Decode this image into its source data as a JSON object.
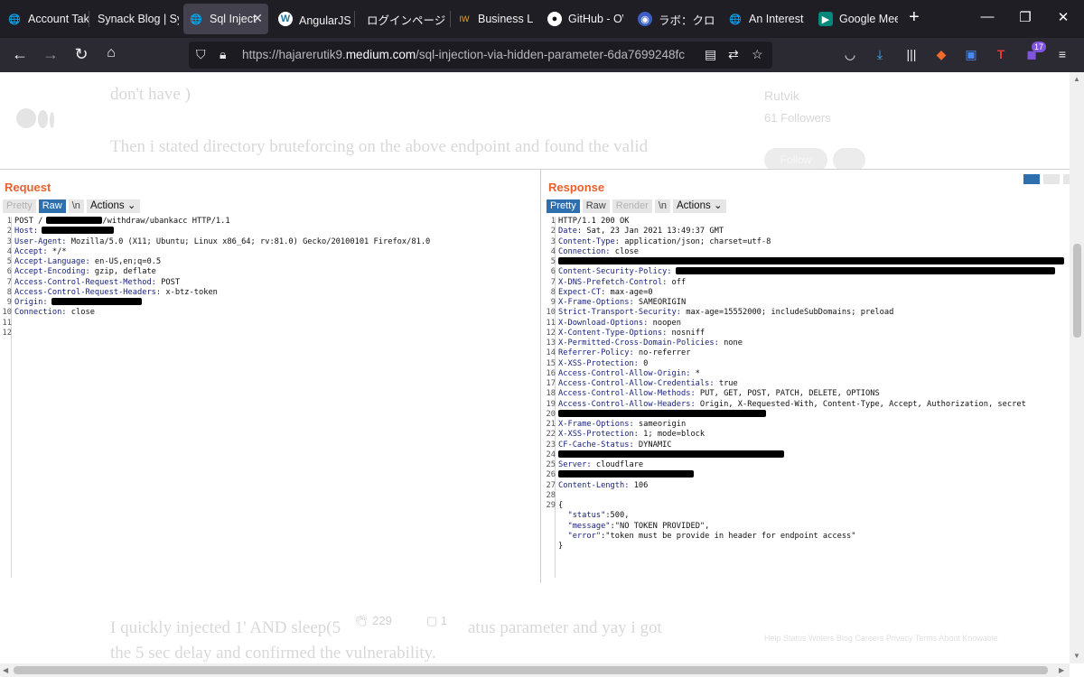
{
  "tabs": [
    {
      "title": "Account Tak",
      "icon": "globe-icon",
      "active": false
    },
    {
      "title": "Synack Blog | Sy",
      "icon": "none",
      "active": false
    },
    {
      "title": "Sql Inject",
      "icon": "globe-icon",
      "active": true
    },
    {
      "title": "AngularJSク",
      "icon": "wordpress-icon",
      "active": false
    },
    {
      "title": "ログインページ",
      "icon": "none",
      "active": false
    },
    {
      "title": "Business Lo",
      "icon": "iw-icon",
      "active": false
    },
    {
      "title": "GitHub - OW",
      "icon": "github-icon",
      "active": false
    },
    {
      "title": "ラボ：クロスサ",
      "icon": "portswigger-icon",
      "active": false
    },
    {
      "title": "An Interesti",
      "icon": "globe-icon",
      "active": false
    },
    {
      "title": "Google Mee",
      "icon": "google-meet-icon",
      "active": false
    }
  ],
  "address": {
    "prefix": "https://hajarerutik9.",
    "domain": "medium.com",
    "path": "/sql-injection-via-hidden-parameter-6da7699248fc"
  },
  "toolbar_badge": "17",
  "article": {
    "top_line": "don't have )",
    "para": "Then i stated directory bruteforcing on the above endpoint and found the valid",
    "author": "Rutvik",
    "followers": "61 Followers",
    "follow_label": "Follow",
    "bottom_line1_a": "I quickly injected ",
    "bottom_line1_b": "1' AND sleep(5",
    "bottom_line1_c": "atus parameter and yay i got",
    "bottom_line2": "the 5 sec delay and confirmed the vulnerability.",
    "claps": "229",
    "responses": "1",
    "footer": "Help   Status   Writers   Blog   Careers   Privacy   Terms   About   Knowable"
  },
  "burp": {
    "request_title": "Request",
    "response_title": "Response",
    "req_buttons": {
      "pretty": "Pretty",
      "raw": "Raw",
      "newline": "\\n",
      "actions": "Actions"
    },
    "res_buttons": {
      "pretty": "Pretty",
      "raw": "Raw",
      "render": "Render",
      "newline": "\\n",
      "actions": "Actions"
    },
    "request_lines": [
      {
        "n": "1",
        "k": "POST /",
        "r": 62,
        "v": "/withdraw/ubankacc HTTP/1.1",
        "plain": true
      },
      {
        "n": "2",
        "k": "Host:",
        "r": 80,
        "v": ""
      },
      {
        "n": "3",
        "k": "User-Agent:",
        "v": " Mozilla/5.0 (X11; Ubuntu; Linux x86_64; rv:81.0) Gecko/20100101 Firefox/81.0"
      },
      {
        "n": "4",
        "k": "Accept:",
        "v": " */*"
      },
      {
        "n": "5",
        "k": "Accept-Language:",
        "v": " en-US,en;q=0.5"
      },
      {
        "n": "6",
        "k": "Accept-Encoding:",
        "v": " gzip, deflate"
      },
      {
        "n": "7",
        "k": "Access-Control-Request-Method:",
        "v": " POST"
      },
      {
        "n": "8",
        "k": "Access-Control-Request-Headers:",
        "v": " x-btz-token"
      },
      {
        "n": "9",
        "k": "Origin:",
        "r": 100,
        "v": ""
      },
      {
        "n": "10",
        "k": "Connection:",
        "v": " close"
      },
      {
        "n": "11",
        "k": "",
        "v": ""
      },
      {
        "n": "12",
        "k": "",
        "v": ""
      }
    ],
    "response_lines": [
      {
        "n": "1",
        "k": "HTTP/1.1 200 OK",
        "v": "",
        "plain": true
      },
      {
        "n": "2",
        "k": "Date:",
        "v": " Sat, 23 Jan 2021 13:49:37 GMT"
      },
      {
        "n": "3",
        "k": "Content-Type:",
        "v": " application/json; charset=utf-8"
      },
      {
        "n": "4",
        "k": "Connection:",
        "v": " close"
      },
      {
        "n": "5",
        "k": "",
        "r": 560,
        "v": ""
      },
      {
        "n": "6",
        "k": "Content-Security-Policy:",
        "r": 420,
        "v": ""
      },
      {
        "n": "7",
        "k": "X-DNS-Prefetch-Control:",
        "v": " off"
      },
      {
        "n": "8",
        "k": "Expect-CT:",
        "v": " max-age=0"
      },
      {
        "n": "9",
        "k": "X-Frame-Options:",
        "v": " SAMEORIGIN"
      },
      {
        "n": "10",
        "k": "Strict-Transport-Security:",
        "v": " max-age=15552000; includeSubDomains; preload"
      },
      {
        "n": "11",
        "k": "X-Download-Options:",
        "v": " noopen"
      },
      {
        "n": "12",
        "k": "X-Content-Type-Options:",
        "v": " nosniff"
      },
      {
        "n": "13",
        "k": "X-Permitted-Cross-Domain-Policies:",
        "v": " none"
      },
      {
        "n": "14",
        "k": "Referrer-Policy:",
        "v": " no-referrer"
      },
      {
        "n": "15",
        "k": "X-XSS-Protection:",
        "v": " 0"
      },
      {
        "n": "16",
        "k": "Access-Control-Allow-Origin:",
        "v": " *"
      },
      {
        "n": "17",
        "k": "Access-Control-Allow-Credentials:",
        "v": " true"
      },
      {
        "n": "18",
        "k": "Access-Control-Allow-Methods:",
        "v": " PUT, GET, POST, PATCH, DELETE, OPTIONS"
      },
      {
        "n": "19",
        "k": "Access-Control-Allow-Headers:",
        "v": " Origin, X-Requested-With, Content-Type, Accept, Authorization, secret"
      },
      {
        "n": "20",
        "k": "",
        "r": 230,
        "v": ""
      },
      {
        "n": "21",
        "k": "X-Frame-Options:",
        "v": " sameorigin"
      },
      {
        "n": "22",
        "k": "X-XSS-Protection:",
        "v": " 1; mode=block"
      },
      {
        "n": "23",
        "k": "CF-Cache-Status:",
        "v": " DYNAMIC"
      },
      {
        "n": "24",
        "k": "",
        "r": 250,
        "v": ""
      },
      {
        "n": "25",
        "k": "Server:",
        "v": " cloudflare"
      },
      {
        "n": "26",
        "k": "",
        "r": 150,
        "v": ""
      },
      {
        "n": "27",
        "k": "Content-Length:",
        "v": " 106"
      },
      {
        "n": "28",
        "k": "",
        "v": ""
      },
      {
        "n": "29",
        "k": "{",
        "v": "",
        "plain": true
      },
      {
        "n": "",
        "k": "  \"status\"",
        "v": ":500,",
        "json": true
      },
      {
        "n": "",
        "k": "  \"message\"",
        "v": ":\"NO TOKEN PROVIDED\",",
        "json": true
      },
      {
        "n": "",
        "k": "  \"error\"",
        "v": ":\"token must be provide in header for endpoint access\"",
        "json": true
      },
      {
        "n": "",
        "k": "}",
        "v": "",
        "plain": true
      }
    ]
  }
}
